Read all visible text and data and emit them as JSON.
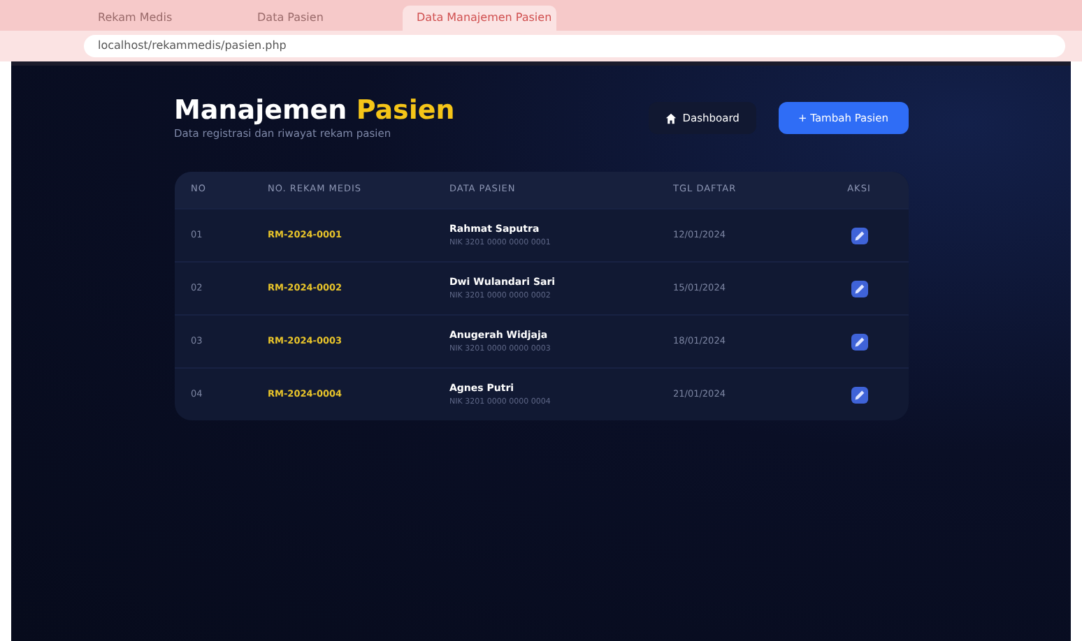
{
  "browser": {
    "tabs": [
      {
        "title": "Rekam Medis",
        "selected": false
      },
      {
        "title": "Data Pasien",
        "selected": false
      },
      {
        "title": "Data Manajemen Pasien",
        "selected": true
      }
    ],
    "url": "localhost/rekammedis/pasien.php"
  },
  "header": {
    "title": "Manajemen",
    "title_highlight": "Pasien",
    "subtitle": "Data registrasi dan riwayat rekam pasien"
  },
  "buttons": [
    {
      "kind": "secondary",
      "label": "Dashboard"
    },
    {
      "kind": "primary",
      "label": "+ Tambah Pasien"
    }
  ],
  "table": {
    "columns": [
      "NO",
      "NO. REKAM MEDIS",
      "DATA PASIEN",
      "TGL DAFTAR",
      "AKSI"
    ],
    "rows": [
      {
        "no": "01",
        "record": "RM-2024-0001",
        "name": "Rahmat Saputra",
        "detail": "NIK 3201 0000 0000 0001",
        "date": "12/01/2024"
      },
      {
        "no": "02",
        "record": "RM-2024-0002",
        "name": "Dwi Wulandari Sari",
        "detail": "NIK 3201 0000 0000 0002",
        "date": "15/01/2024"
      },
      {
        "no": "03",
        "record": "RM-2024-0003",
        "name": "Anugerah Widjaja",
        "detail": "NIK 3201 0000 0000 0003",
        "date": "18/01/2024"
      },
      {
        "no": "04",
        "record": "RM-2024-0004",
        "name": "Agnes Putri",
        "detail": "NIK 3201 0000 0000 0004",
        "date": "21/01/2024"
      }
    ]
  }
}
